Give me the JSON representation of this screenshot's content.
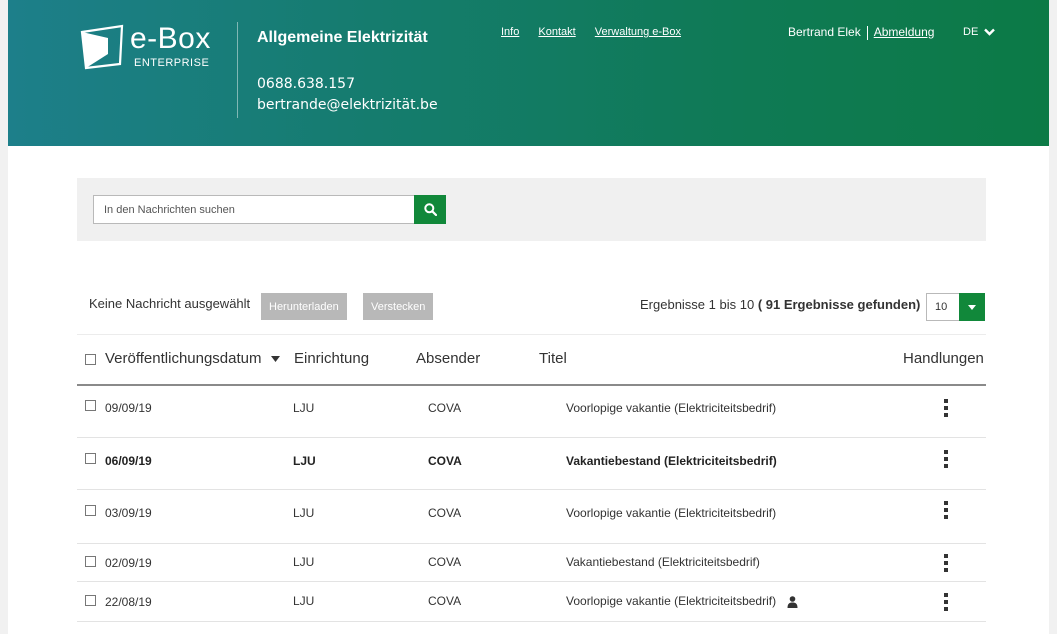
{
  "header": {
    "logo": {
      "name": "e-Box",
      "sub": "ENTERPRISE"
    },
    "org_name": "Allgemeine Elektrizität",
    "phone": "0688.638.157",
    "email": "bertrande@elektrizität.be",
    "links": [
      "Info",
      "Kontakt",
      "Verwaltung e-Box"
    ],
    "user_name": "Bertrand Elek",
    "logout": "Abmeldung",
    "language": "DE"
  },
  "search": {
    "placeholder": "In den Nachrichten suchen"
  },
  "toolbar": {
    "selection_status": "Keine Nachricht ausgewählt",
    "download_label": "Herunterladen",
    "hide_label": "Verstecken",
    "results_prefix": "Ergebnisse 1 bis 10",
    "results_count": "( 91 Ergebnisse gefunden)",
    "page_size": "10"
  },
  "table": {
    "columns": [
      "Veröffentlichungsdatum",
      "Einrichtung",
      "Absender",
      "Titel",
      "Handlungen"
    ],
    "rows": [
      {
        "date": "09/09/19",
        "org": "LJU",
        "sender": "COVA",
        "title": "Voorlopige vakantie (Elektriciteitsbedrif)"
      },
      {
        "date": "06/09/19",
        "org": "LJU",
        "sender": "COVA",
        "title": "Vakantiebestand (Elektriciteitsbedrif)"
      },
      {
        "date": "03/09/19",
        "org": "LJU",
        "sender": "COVA",
        "title": "Voorlopige vakantie (Elektriciteitsbedrif)"
      },
      {
        "date": "02/09/19",
        "org": "LJU",
        "sender": "COVA",
        "title": "Vakantiebestand (Elektriciteitsbedrif)"
      },
      {
        "date": "22/08/19",
        "org": "LJU",
        "sender": "COVA",
        "title": "Voorlopige vakantie (Elektriciteitsbedrif)"
      }
    ]
  },
  "icons": {
    "search": "search-icon",
    "dropdown": "chevron-down-icon",
    "sort": "sort-desc-icon",
    "actions": "kebab-menu-icon",
    "personal": "person-icon"
  },
  "colors": {
    "header_start": "#1d7f8a",
    "header_end": "#0c7a46",
    "accent": "#11883a",
    "button_disabled": "#b8b8b8"
  }
}
